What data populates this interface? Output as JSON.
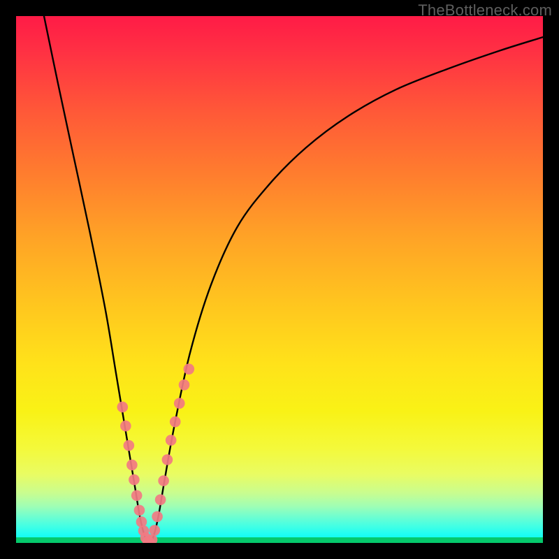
{
  "watermark": "TheBottleneck.com",
  "chart_data": {
    "type": "line",
    "title": "",
    "xlabel": "",
    "ylabel": "",
    "xlim": [
      0,
      100
    ],
    "ylim": [
      0,
      100
    ],
    "grid": false,
    "legend": false,
    "annotations": [],
    "series": [
      {
        "name": "bottleneck-curve",
        "color": "#000000",
        "x": [
          5.3,
          8,
          11,
          14,
          17,
          19,
          21,
          22.5,
          23.5,
          24.5,
          25.2,
          26,
          27,
          28.2,
          30,
          33,
          37,
          42,
          48,
          55,
          63,
          72,
          82,
          92,
          100
        ],
        "y": [
          100,
          87,
          73,
          59,
          44,
          32,
          20,
          11,
          5,
          1,
          0,
          1,
          5,
          12,
          22,
          36,
          49,
          60,
          68,
          75,
          81,
          86,
          90,
          93.5,
          96
        ]
      },
      {
        "name": "highlight-dots-left",
        "type": "scatter",
        "color": "#f27a82",
        "x": [
          20.2,
          20.8,
          21.4,
          22.0,
          22.4,
          22.9,
          23.4,
          23.8,
          24.2,
          24.6,
          25.0,
          25.3
        ],
        "y": [
          25.8,
          22.2,
          18.5,
          14.8,
          12.0,
          9.0,
          6.2,
          4.0,
          2.3,
          1.0,
          0.3,
          0.1
        ]
      },
      {
        "name": "highlight-dots-right",
        "type": "scatter",
        "color": "#f27a82",
        "x": [
          25.8,
          26.3,
          26.8,
          27.4,
          28.0,
          28.7,
          29.4,
          30.2,
          31.0,
          31.9,
          32.8
        ],
        "y": [
          0.6,
          2.4,
          5.0,
          8.2,
          11.8,
          15.8,
          19.5,
          23.0,
          26.5,
          30.0,
          33.0
        ]
      }
    ],
    "background_gradient": {
      "type": "vertical",
      "stops": [
        {
          "pos": 0,
          "color": "#ff1b46"
        },
        {
          "pos": 50,
          "color": "#ffc41f"
        },
        {
          "pos": 80,
          "color": "#f4f93a"
        },
        {
          "pos": 100,
          "color": "#08f7e8"
        }
      ]
    }
  }
}
